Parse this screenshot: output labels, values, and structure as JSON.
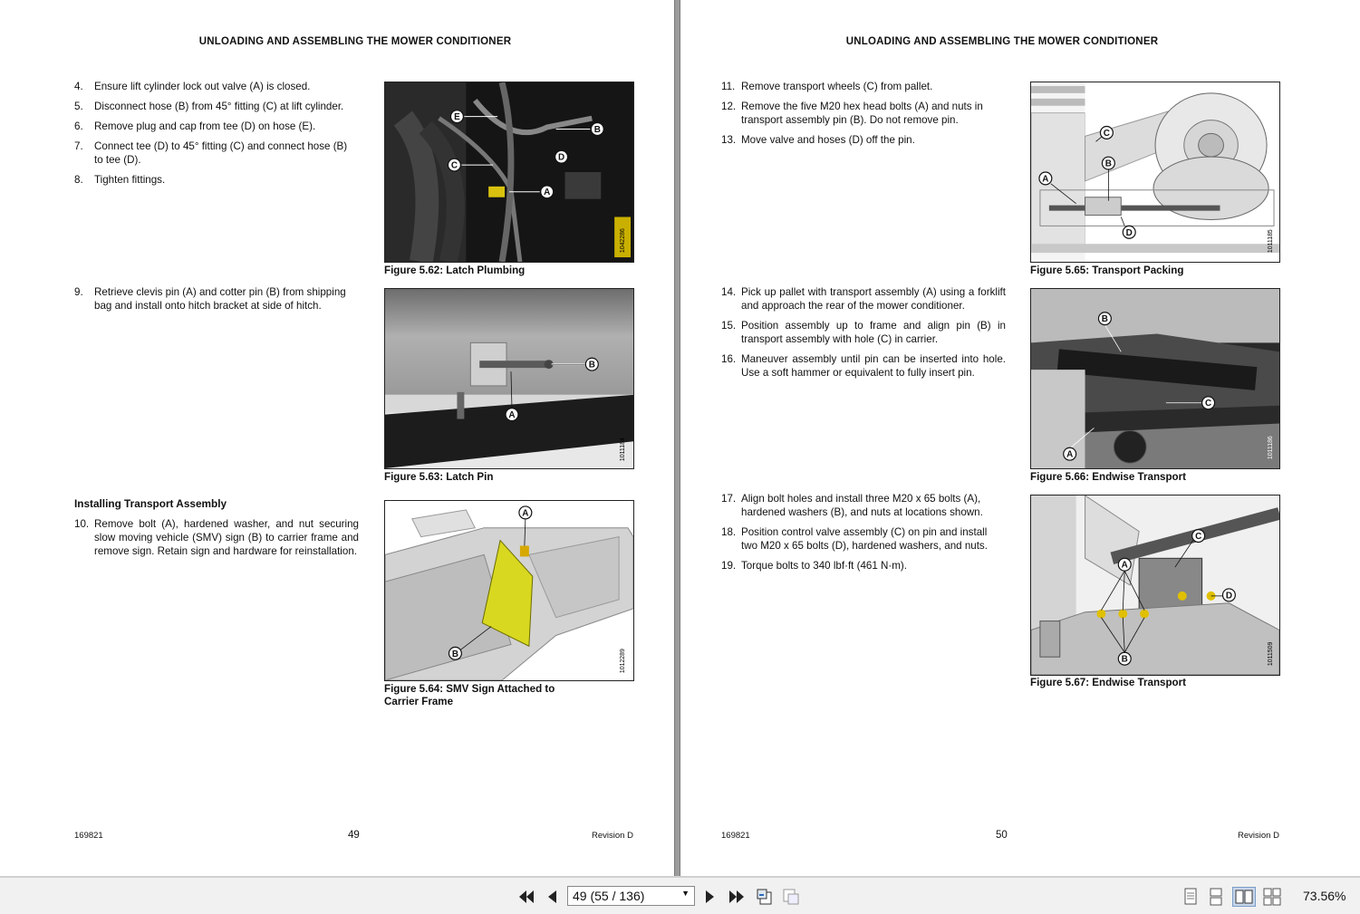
{
  "left_page": {
    "header": "UNLOADING AND ASSEMBLING THE MOWER CONDITIONER",
    "steps_a": [
      {
        "n": "4.",
        "text": "Ensure lift cylinder lock out valve (A) is closed."
      },
      {
        "n": "5.",
        "text": "Disconnect hose (B) from 45° fitting (C) at lift cylinder."
      },
      {
        "n": "6.",
        "text": "Remove plug and cap from tee (D) on hose (E)."
      },
      {
        "n": "7.",
        "text": "Connect tee (D) to 45° fitting (C) and connect hose (B) to tee (D)."
      },
      {
        "n": "8.",
        "text": "Tighten fittings."
      }
    ],
    "steps_b": [
      {
        "n": "9.",
        "text": "Retrieve clevis pin (A) and cotter pin (B) from shipping bag and install onto hitch bracket at side of hitch."
      }
    ],
    "subheading": "Installing Transport Assembly",
    "steps_c": [
      {
        "n": "10.",
        "text": "Remove bolt (A), hardened washer, and nut securing slow moving vehicle (SMV) sign (B) to carrier frame and remove sign.  Retain sign and hardware for reinstallation."
      }
    ],
    "figures": [
      {
        "caption": "Figure 5.62: Latch Plumbing",
        "code": "1042286",
        "callouts": [
          "E",
          "B",
          "C",
          "D",
          "A"
        ]
      },
      {
        "caption": "Figure 5.63: Latch Pin",
        "code": "1011184",
        "callouts": [
          "B",
          "A"
        ]
      },
      {
        "caption": "Figure 5.64:  SMV Sign Attached to Carrier Frame",
        "code": "1012289",
        "callouts": [
          "A",
          "B"
        ]
      }
    ],
    "doc_number": "169821",
    "page_number": "49",
    "revision": "Revision  D"
  },
  "right_page": {
    "header": "UNLOADING AND ASSEMBLING THE MOWER CONDITIONER",
    "steps_a": [
      {
        "n": "11.",
        "text": "Remove transport wheels (C) from pallet."
      },
      {
        "n": "12.",
        "text": "Remove the five M20 hex head bolts (A) and nuts in transport assembly pin (B). Do not remove pin."
      },
      {
        "n": "13.",
        "text": "Move valve and hoses (D) off the pin."
      }
    ],
    "steps_b": [
      {
        "n": "14.",
        "text": "Pick up pallet with transport assembly (A) using a forklift and approach the rear of the mower conditioner."
      },
      {
        "n": "15.",
        "text": "Position assembly up to frame and align pin (B) in transport assembly with hole (C) in carrier."
      },
      {
        "n": "16.",
        "text": "Maneuver assembly until pin can be inserted into hole. Use a soft hammer or equivalent to fully insert pin."
      }
    ],
    "steps_c": [
      {
        "n": "17.",
        "text": "Align bolt holes and install three M20 x 65 bolts (A), hardened washers (B), and nuts at locations shown."
      },
      {
        "n": "18.",
        "text": "Position control valve assembly (C) on pin and install two M20 x 65 bolts (D), hardened washers, and nuts."
      },
      {
        "n": "19.",
        "text": "Torque bolts to 340 lbf·ft (461 N·m)."
      }
    ],
    "figures": [
      {
        "caption": "Figure 5.65: Transport Packing",
        "code": "1011185",
        "callouts": [
          "C",
          "B",
          "A",
          "D"
        ]
      },
      {
        "caption": "Figure 5.66: Endwise Transport",
        "code": "1011186",
        "callouts": [
          "B",
          "C",
          "A"
        ]
      },
      {
        "caption": "Figure 5.67: Endwise Transport",
        "code": "1011509",
        "callouts": [
          "C",
          "A",
          "D",
          "B"
        ]
      }
    ],
    "doc_number": "169821",
    "page_number": "50",
    "revision": "Revision  D"
  },
  "toolbar": {
    "page_field": "49 (55 / 136)",
    "zoom": "73.56%",
    "icons": [
      "first-page-icon",
      "prev-page-icon",
      "next-page-icon",
      "last-page-icon",
      "previous-view-icon",
      "next-view-icon",
      "single-page-view-icon",
      "continuous-view-icon",
      "facing-view-icon",
      "continuous-facing-view-icon"
    ]
  },
  "colors": {
    "page": "#ffffff",
    "background": "#a9a9a9",
    "smv_sign": "#d8d820",
    "toolbar": "#f1f1f1"
  }
}
